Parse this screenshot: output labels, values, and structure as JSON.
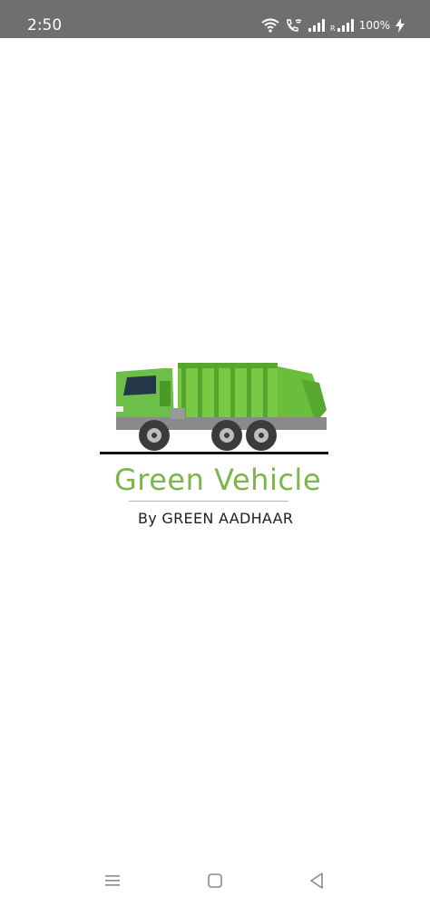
{
  "status_bar": {
    "time": "2:50",
    "battery_percent": "100%",
    "icons": [
      "wifi-icon",
      "wifi-calling-icon",
      "signal-icon",
      "signal-roaming-icon",
      "charging-icon"
    ]
  },
  "splash": {
    "title": "Green Vehicle",
    "subtitle": "By GREEN AADHAAR",
    "brand_color": "#7ab648",
    "truck_color": "#6cc04a"
  },
  "nav_bar": {
    "buttons": [
      "menu-icon",
      "home-icon",
      "back-icon"
    ]
  }
}
